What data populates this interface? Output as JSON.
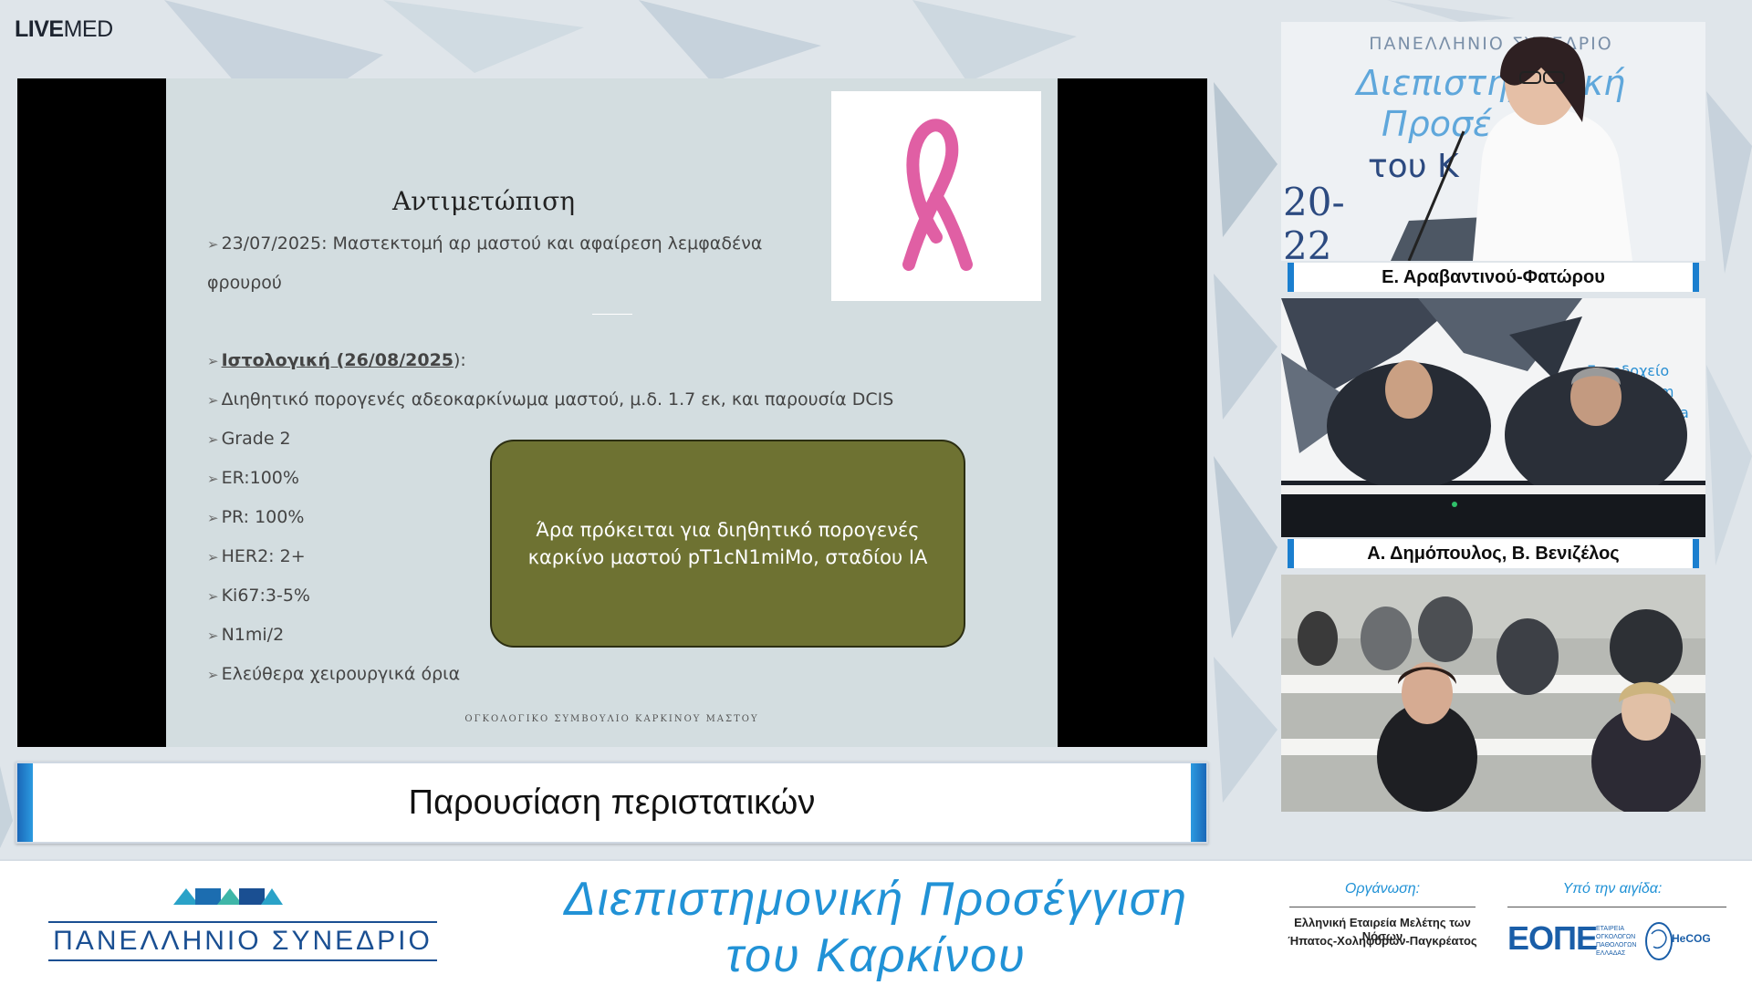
{
  "brand": {
    "bold": "LIVE",
    "light": "MED"
  },
  "slide": {
    "title": "Αντιμετώπιση",
    "treatment_line1": "23/07/2025: Μαστεκτομή αρ μαστού και αφαίρεση λεμφαδένα",
    "treatment_line2": "φρουρού",
    "histology_label": "Ιστολογική (26/08/2025",
    "histology_suffix": "):",
    "bullets": [
      "Διηθητικό πορογενές αδεοκαρκίνωμα μαστού, μ.δ. 1.7 εκ, και παρουσία DCIS",
      "Grade 2",
      "ER:100%",
      "PR: 100%",
      "HER2: 2+",
      "Ki67:3-5%",
      "N1mi/2",
      "Ελεύθερα χειρουργικά όρια"
    ],
    "callout_line1": "Άρα πρόκειται για διηθητικό πορογενές",
    "callout_line2": "καρκίνο μαστού pT1cN1miMo, σταδίου ΙΑ",
    "footer": "ΟΓΚΟΛΟΓΙΚΟ ΣΥΜΒΟΥΛΙΟ ΚΑΡΚΙΝΟΥ ΜΑΣΤΟΥ",
    "ribbon_color": "#e05fa4"
  },
  "topic": "Παρουσίαση περιστατικών",
  "speakers": {
    "speaker1": "Ε. Αραβαντινού-Φατώρου",
    "speaker2": "Α. Δημόπουλος, Β. Βενιζέλος"
  },
  "video_backdrop": {
    "congress": "ΠΑΝΕΛΛΗΝΙΟ ΣΥΝΕΔΡΙΟ",
    "title_a": "Διεπιστημονική",
    "title_b": "Προσέ",
    "title_c": "του Κ",
    "date_a": "20-",
    "date_b": "22",
    "hotel_a": "Ξενοδοχείο",
    "hotel_b": "henaeum",
    "hotel_c": "ontinenta"
  },
  "banner": {
    "congress": "ΠΑΝΕΛΛΗΝΙΟ ΣΥΝΕΔΡΙΟ",
    "title_line1": "Διεπιστημονική Προσέγγιση",
    "title_line2": "του Καρκίνου",
    "organization_label": "Οργάνωση:",
    "organization_line1": "Ελληνική Εταιρεία Μελέτης των Νόσων",
    "organization_line2": "Ήπατος-Χοληφόρων-Παγκρέατος",
    "auspices_label": "Υπό την αιγίδα:",
    "eope": "ΕΟΠΕ",
    "eope_sub": "ΕΤΑΙΡΕΙΑ ΟΓΚΟΛΟΓΩΝ ΠΑΘΟΛΟΓΩΝ ΕΛΛΑΔΑΣ",
    "hecog": "HeCOG",
    "accent_color": "#2192d6"
  }
}
